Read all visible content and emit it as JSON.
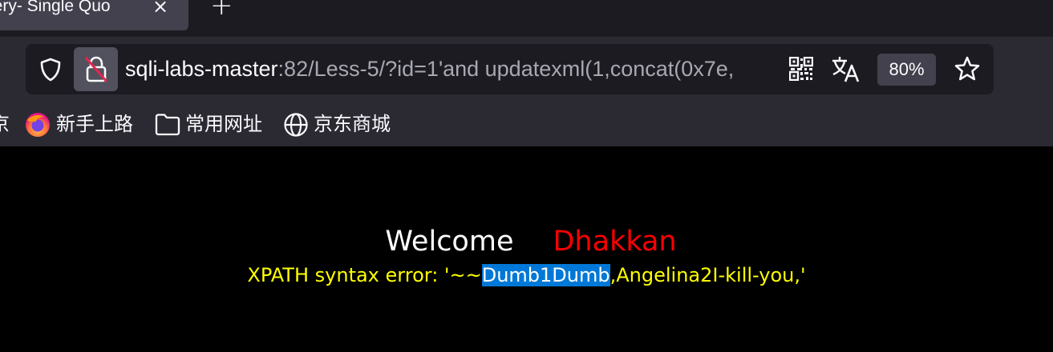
{
  "tab": {
    "title": "uery- Single Quo",
    "close_glyph": "×",
    "new_tab_glyph": "+"
  },
  "urlbar": {
    "host": "sqli-labs-master",
    "path": ":82/Less-5/?id=1'and updatexml(1,concat(0x7e,",
    "zoom": "80%"
  },
  "bookmarks": [
    {
      "icon": "firefox-icon",
      "label": "新手上路"
    },
    {
      "icon": "folder-icon",
      "label": "常用网址"
    },
    {
      "icon": "globe-icon",
      "label": "京东商城"
    }
  ],
  "bookmark_edge_label": "京",
  "page": {
    "welcome": "Welcome",
    "name": "Dhakkan",
    "error_prefix": "XPATH syntax error: '~~",
    "error_selected": "Dumb1Dumb",
    "error_suffix": ",Angelina2I-kill-you,'"
  },
  "colors": {
    "page_bg": "#000000",
    "welcome": "#ffffff",
    "name": "#ff0000",
    "error": "#ffff00",
    "selection": "#0078d7",
    "chrome": "#2b2a33"
  }
}
